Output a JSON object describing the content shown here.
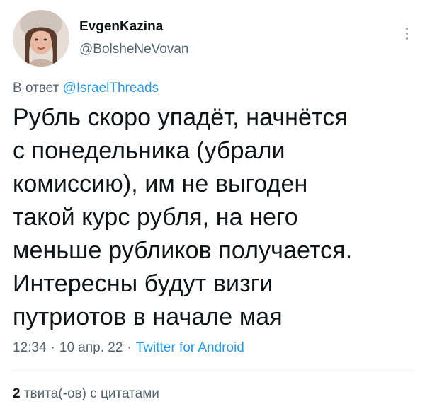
{
  "author": {
    "display_name": "EvgenKazina",
    "handle": "@BolsheNeVovan"
  },
  "reply": {
    "prefix": "В ответ",
    "mention": "@IsraelThreads"
  },
  "tweet": {
    "text": "Рубль скоро упадёт, начнётся\nс понедельника (убрали\nкомиссию), им не выгоден\nтакой курс рубля, на него\nменьше рубликов получается.\nИнтересны будут визги\nпутриотов в начале мая"
  },
  "meta": {
    "time": "12:34",
    "date": "10 апр. 22",
    "source": "Twitter for Android",
    "separator": "·"
  },
  "stats": {
    "quote_count": "2",
    "quote_label": "твита(-ов) с цитатами"
  },
  "colors": {
    "link": "#1d9bf0",
    "secondary_text": "#536471",
    "primary_text": "#0f1419"
  },
  "icons": {
    "more": "more-vertical-icon"
  }
}
